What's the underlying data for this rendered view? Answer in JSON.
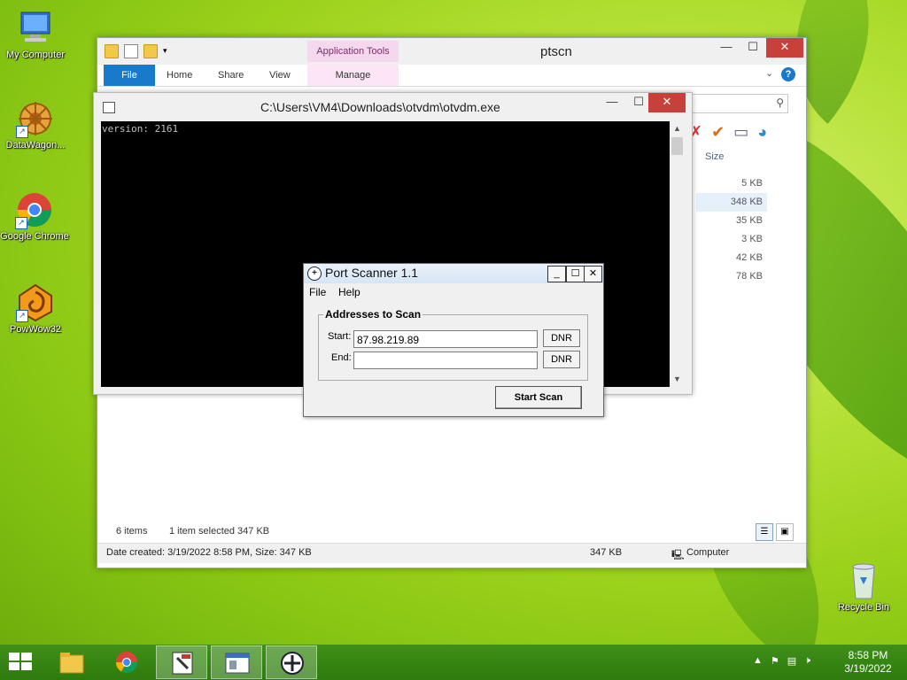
{
  "desktop": {
    "icons": [
      {
        "label": "My Computer"
      },
      {
        "label": "DataWagon..."
      },
      {
        "label": "Google Chrome"
      },
      {
        "label": "PowWow32"
      }
    ],
    "recycle_bin": "Recycle Bin"
  },
  "explorer": {
    "title": "ptscn",
    "app_tools_label": "Application Tools",
    "tabs": {
      "file": "File",
      "home": "Home",
      "share": "Share",
      "view": "View",
      "manage": "Manage"
    },
    "size_header": "Size",
    "sizes": [
      "5 KB",
      "348 KB",
      "35 KB",
      "3 KB",
      "42 KB",
      "78 KB"
    ],
    "item_count": "6 items",
    "selection": "1 item selected  347 KB",
    "status_info": "Date created: 3/19/2022 8:58 PM, Size: 347 KB",
    "status_size": "347 KB",
    "status_location": "Computer"
  },
  "console": {
    "title": "C:\\Users\\VM4\\Downloads\\otvdm\\otvdm.exe",
    "output": "version: 2161"
  },
  "scanner": {
    "title": "Port Scanner 1.1",
    "menu": {
      "file": "File",
      "help": "Help"
    },
    "group_label": "Addresses to Scan",
    "start_label": "Start:",
    "end_label": "End:",
    "start_value": "87.98.219.89",
    "end_value": "",
    "dnr_label": "DNR",
    "scan_button": "Start Scan"
  },
  "taskbar": {
    "time": "8:58 PM",
    "date": "3/19/2022"
  },
  "colors": {
    "accent": "#1979ca",
    "close": "#c7403a",
    "taskbar": "#2e7a0e"
  }
}
